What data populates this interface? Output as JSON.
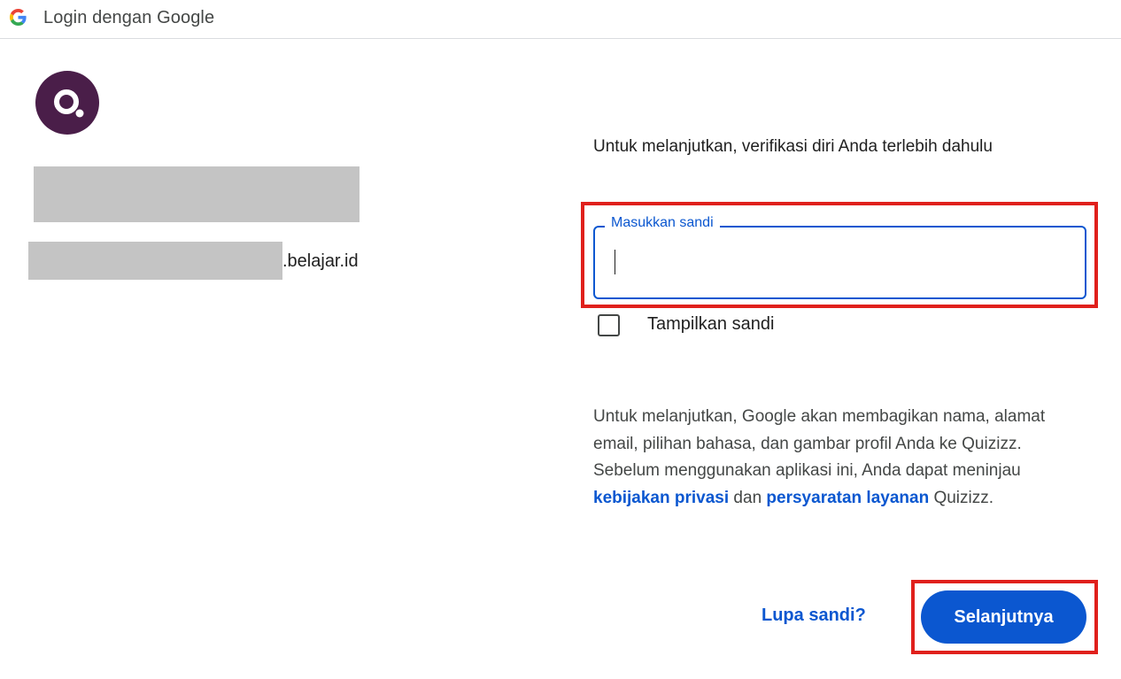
{
  "header": {
    "title": "Login dengan Google",
    "icon": "google-g-icon"
  },
  "account": {
    "app_logo_icon": "quizizz-logo-icon",
    "app_logo_color": "#4a1e49",
    "email_domain": ".belajar.id"
  },
  "main": {
    "verify_text": "Untuk melanjutkan, verifikasi diri Anda terlebih dahulu",
    "password_field": {
      "label": "Masukkan sandi",
      "value": ""
    },
    "show_password_label": "Tampilkan sandi",
    "consent": {
      "part1": "Untuk melanjutkan, Google akan membagikan nama, alamat email, pilihan bahasa, dan gambar profil Anda ke Quizizz. Sebelum menggunakan aplikasi ini, Anda dapat meninjau ",
      "privacy_link": "kebijakan privasi",
      "part2": " dan ",
      "terms_link": "persyaratan layanan",
      "part3": " Quizizz."
    },
    "forgot_password": "Lupa sandi?",
    "next_button": "Selanjutnya"
  },
  "colors": {
    "accent": "#0b57d0",
    "highlight": "#e0201c"
  }
}
